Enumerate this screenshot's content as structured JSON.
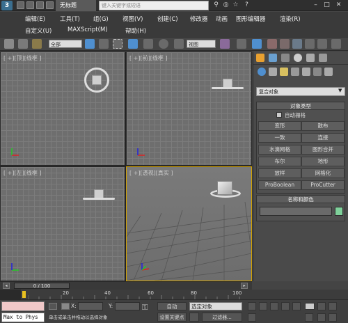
{
  "titlebar": {
    "logo": "3",
    "title": "无标题",
    "search_placeholder": "键入关键字或短语"
  },
  "menu": {
    "row1": [
      "编辑(E)",
      "工具(T)",
      "组(G)",
      "视图(V)",
      "创建(C)",
      "修改器",
      "动画",
      "图形编辑器",
      "渲染(R)"
    ],
    "row2": [
      "自定义(U)",
      "MAXScript(M)",
      "帮助(H)"
    ]
  },
  "toolbar": {
    "filter_value": "全部",
    "view_value": "视图"
  },
  "viewports": {
    "top": "[ +][顶][线框 ]",
    "front": "[ +][前][线框 ]",
    "left": "[ +][左][线框 ]",
    "persp": "[ +][透视][真实 ]"
  },
  "command_panel": {
    "dropdown": "复合对象",
    "object_type": {
      "title": "对象类型",
      "autogrid": "自动栅格",
      "buttons": [
        "变形",
        "散布",
        "一致",
        "连接",
        "水滴网格",
        "图形合并",
        "布尔",
        "地形",
        "放样",
        "网格化",
        "ProBoolean",
        "ProCutter"
      ]
    },
    "name_color": {
      "title": "名称和颜色",
      "swatch": "#7fd19b"
    }
  },
  "timeline": {
    "frame": "0 / 100"
  },
  "ruler": {
    "ticks": [
      "20",
      "40",
      "60",
      "80",
      "100"
    ]
  },
  "status": {
    "script_listener": "Max to Phys",
    "x_label": "X:",
    "y_label": "Y:",
    "auto_key": "自动",
    "selected_object": "选定对象",
    "set_key": "设置关键点",
    "key_filters": "过滤器...",
    "prompt": "单击或单击并拖动以选择对象"
  }
}
